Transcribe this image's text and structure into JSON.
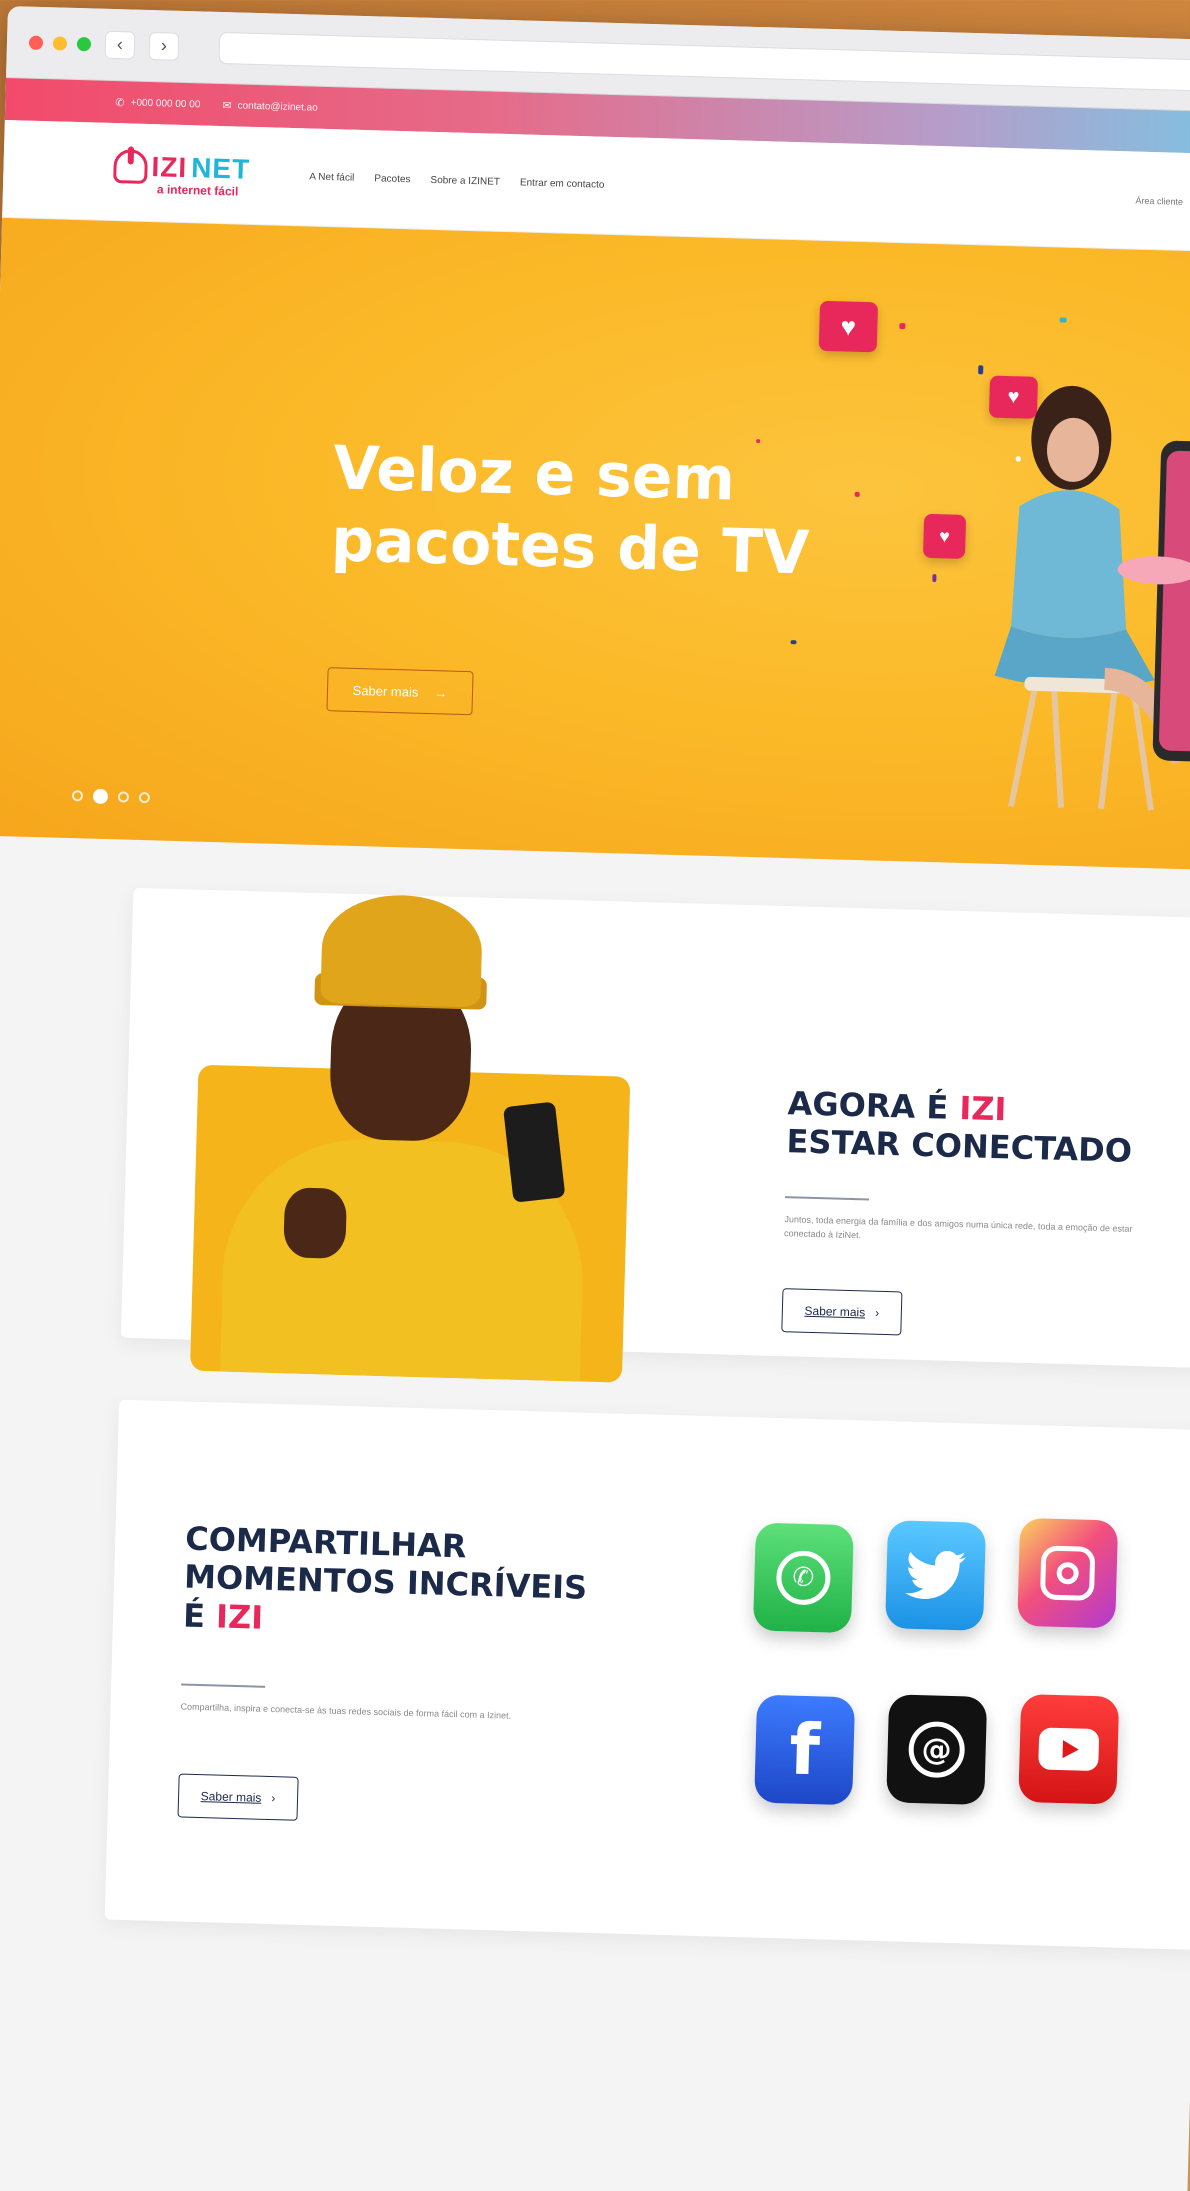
{
  "browser": {
    "back_glyph": "‹",
    "forward_glyph": "›"
  },
  "topbar": {
    "phone": "+000 000 00 00",
    "email": "contato@izinet.ao"
  },
  "header": {
    "brand_izi": "IZI",
    "brand_net": "NET",
    "tagline": "a internet fácil",
    "nav": [
      "A Net fácil",
      "Pacotes",
      "Sobre a IZINET",
      "Entrar em contacto"
    ],
    "right_text": "Área cliente"
  },
  "hero": {
    "title": "Veloz e sem pacotes de TV",
    "button_label": "Saber mais",
    "button_arrow": "→",
    "slides_total": 4,
    "slide_active": 2
  },
  "section1": {
    "title_line1_prefix": "AGORA É ",
    "title_line1_accent": "IZI",
    "title_line2": "ESTAR CONECTADO",
    "text": "Juntos, toda energia da família e dos amigos numa única rede, toda a emoção de estar conectado à IziNet.",
    "button_label": "Saber mais",
    "button_arrow": "›"
  },
  "section2": {
    "title_line1": "COMPARTILHAR",
    "title_line2": "MOMENTOS INCRÍVEIS",
    "title_line3_prefix": "É ",
    "title_line3_accent": "IZI",
    "text": "Compartilha, inspira e conecta-se às tuas redes sociais de forma fácil com a Izinet.",
    "button_label": "Saber mais",
    "button_arrow": "›",
    "social_icons": [
      "whatsapp-icon",
      "twitter-icon",
      "instagram-icon",
      "facebook-icon",
      "threads-icon",
      "youtube-icon"
    ]
  },
  "colors": {
    "brand_pink": "#e8285a",
    "brand_cyan": "#1fb6d9",
    "navy": "#1c2a4a",
    "hero_yellow": "#fbb928"
  }
}
